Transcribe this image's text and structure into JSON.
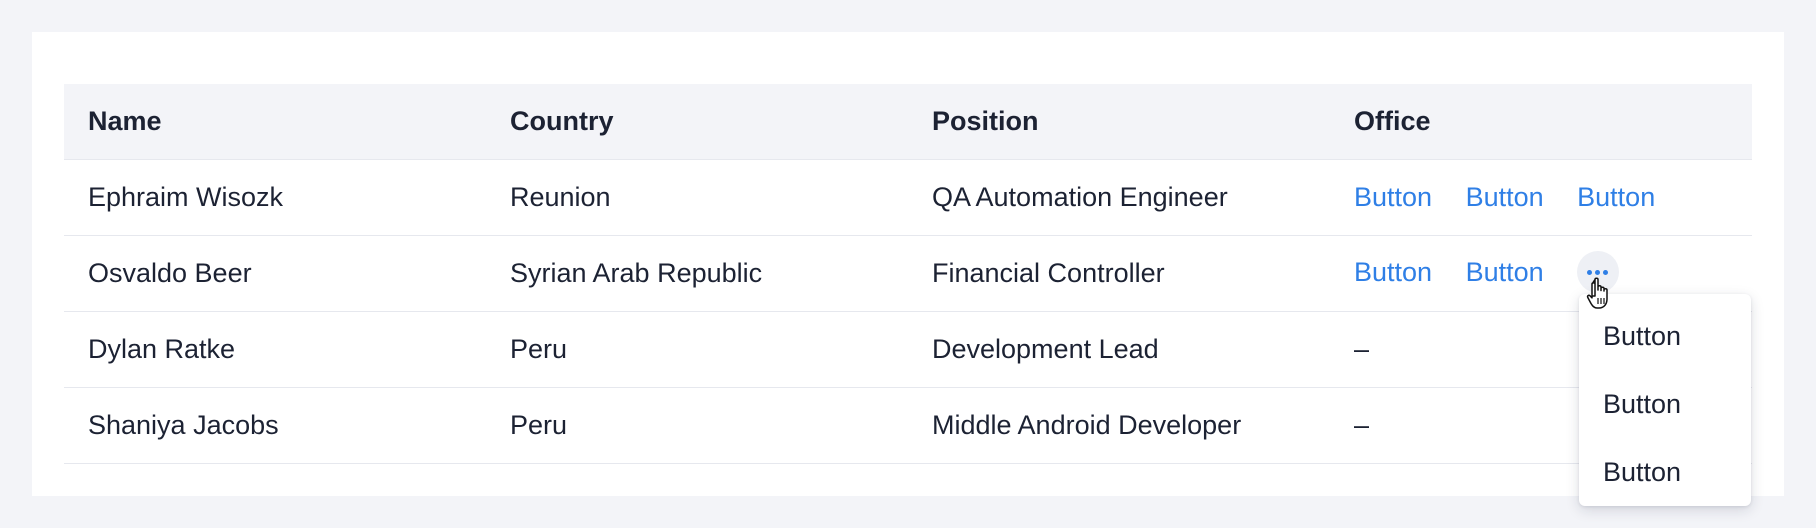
{
  "table": {
    "columns": [
      "Name",
      "Country",
      "Position",
      "Office"
    ],
    "rows": [
      {
        "name": "Ephraim Wisozk",
        "country": "Reunion",
        "position": "QA Automation Engineer",
        "actions": [
          "Button",
          "Button",
          "Button"
        ]
      },
      {
        "name": "Osvaldo Beer",
        "country": "Syrian Arab Republic",
        "position": "Financial Controller",
        "actions": [
          "Button",
          "Button"
        ],
        "more_icon": "more-horizontal-icon"
      },
      {
        "name": "Dylan Ratke",
        "country": "Peru",
        "position": "Development Lead",
        "office": "–"
      },
      {
        "name": "Shaniya Jacobs",
        "country": "Peru",
        "position": "Middle Android Developer",
        "office": "–"
      }
    ]
  },
  "dropdown": {
    "items": [
      "Button",
      "Button",
      "Button"
    ]
  },
  "colors": {
    "page_background": "#f3f4f8",
    "card_background": "#ffffff",
    "header_background": "#f3f4f8",
    "link": "#2f7fe6",
    "text": "#1c2233",
    "border": "#e6e8ee"
  },
  "cursor_icon": "hand-pointer-icon"
}
